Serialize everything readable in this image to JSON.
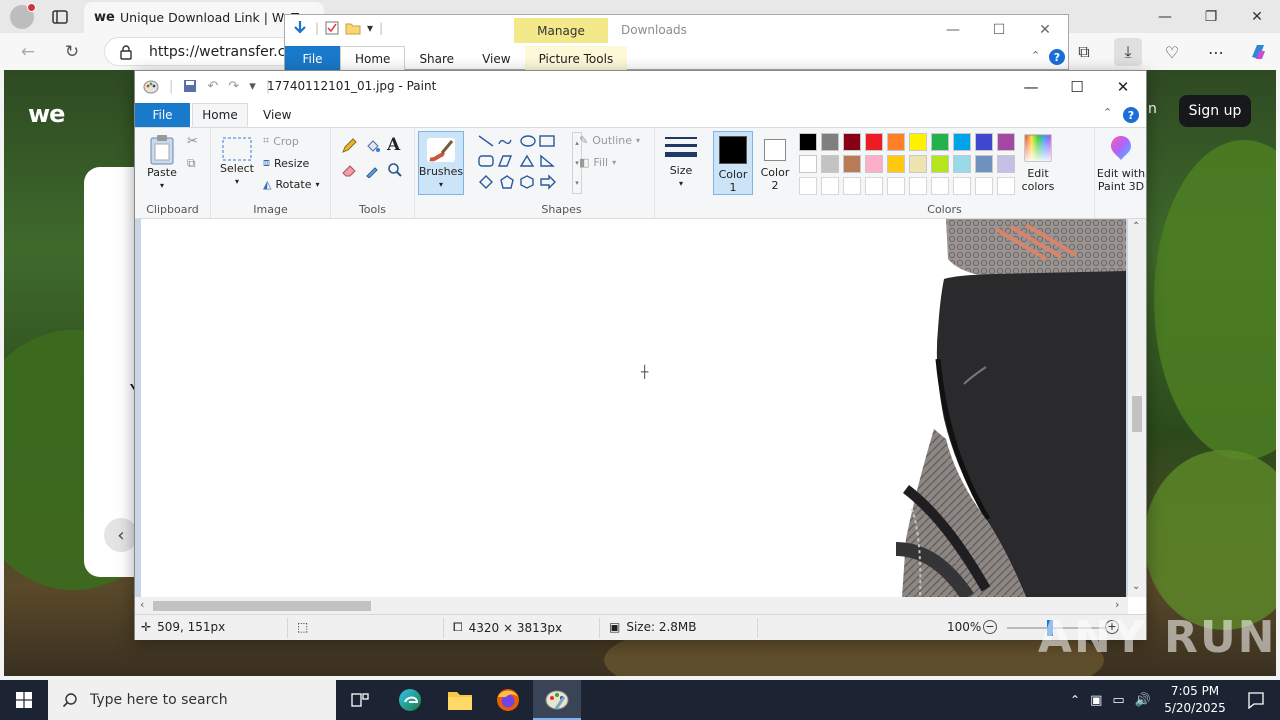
{
  "browser": {
    "tab_title": "Unique Download Link | WeTransfer",
    "favicon_text": "we",
    "url": "https://wetransfer.com",
    "page": {
      "logo_text": "we",
      "login_fragment": "n",
      "signup_label": "Sign up",
      "card_char": "Y"
    }
  },
  "explorer": {
    "manage_label": "Manage",
    "title": "Downloads",
    "tabs": [
      "File",
      "Home",
      "Share",
      "View",
      "Picture Tools"
    ],
    "help": "?"
  },
  "paint": {
    "title": "17740112101_01.jpg - Paint",
    "tabs": {
      "file": "File",
      "home": "Home",
      "view": "View"
    },
    "ribbon": {
      "clipboard": {
        "label": "Clipboard",
        "paste": "Paste"
      },
      "image": {
        "label": "Image",
        "select": "Select",
        "crop": "Crop",
        "resize": "Resize",
        "rotate": "Rotate"
      },
      "tools": {
        "label": "Tools"
      },
      "brushes": "Brushes",
      "shapes": {
        "label": "Shapes",
        "outline": "Outline",
        "fill": "Fill"
      },
      "size": "Size",
      "color1": [
        "Color",
        "1"
      ],
      "color2": [
        "Color",
        "2"
      ],
      "colors": {
        "label": "Colors",
        "edit": [
          "Edit",
          "colors"
        ]
      },
      "paint3d": [
        "Edit with",
        "Paint 3D"
      ]
    },
    "palette_row1": [
      "#000000",
      "#7f7f7f",
      "#880015",
      "#ed1c24",
      "#ff7f27",
      "#fff200",
      "#22b14c",
      "#00a2e8",
      "#3f48cc",
      "#a349a4"
    ],
    "palette_row2": [
      "#ffffff",
      "#c3c3c3",
      "#b97a57",
      "#ffaec9",
      "#ffc90e",
      "#efe4b0",
      "#b5e61d",
      "#99d9ea",
      "#7092be",
      "#c8bfe7"
    ],
    "color1_value": "#000000",
    "color2_value": "#ffffff",
    "status": {
      "cursor_pos": "509, 151px",
      "dimensions": "4320 × 3813px",
      "size": "Size: 2.8MB",
      "zoom": "100%"
    }
  },
  "watermark": "ANY RUN",
  "taskbar": {
    "search_placeholder": "Type here to search",
    "time": "7:05 PM",
    "date": "5/20/2025"
  }
}
